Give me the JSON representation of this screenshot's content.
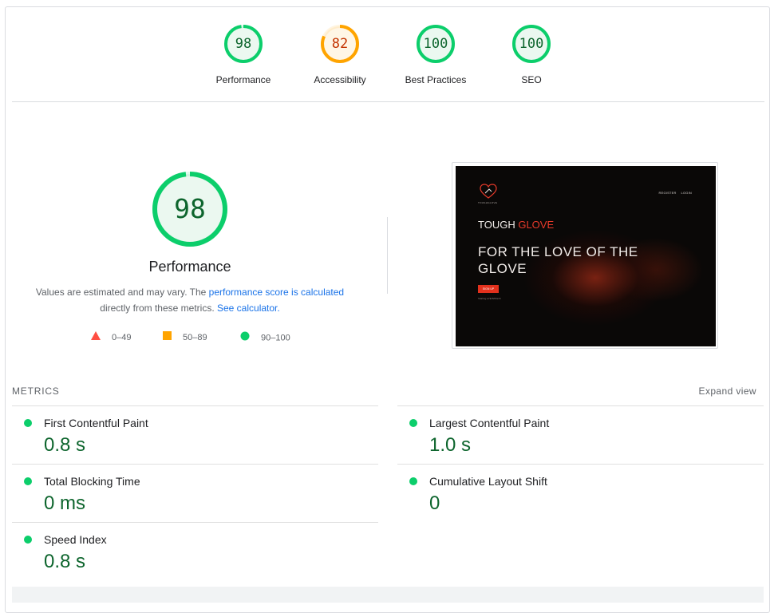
{
  "gauges": [
    {
      "score": "98",
      "label": "Performance",
      "value": 98,
      "color": "#0cce6b",
      "text_color": "#0d652d",
      "fill": "#ebf8f0"
    },
    {
      "score": "82",
      "label": "Accessibility",
      "value": 82,
      "color": "#ffa400",
      "text_color": "#c33300",
      "fill": "#fff6e6"
    },
    {
      "score": "100",
      "label": "Best Practices",
      "value": 100,
      "color": "#0cce6b",
      "text_color": "#0d652d",
      "fill": "#ebf8f0"
    },
    {
      "score": "100",
      "label": "SEO",
      "value": 100,
      "color": "#0cce6b",
      "text_color": "#0d652d",
      "fill": "#ebf8f0"
    }
  ],
  "performance": {
    "score": "98",
    "value": 98,
    "title": "Performance",
    "desc_prefix": "Values are estimated and may vary. The ",
    "desc_link": "performance score is calculated",
    "desc_mid": "directly from these metrics.",
    "desc_link2": "See calculator.",
    "legend": {
      "fail": "0–49",
      "average": "50–89",
      "pass": "90–100"
    },
    "colors": {
      "fail": "#ff4e42",
      "average": "#ffa400",
      "pass": "#0cce6b"
    }
  },
  "screenshot": {
    "nav_register": "REGISTER",
    "nav_login": "LOGIN",
    "brand_main": "TOUGH ",
    "brand_accent": "GLOVE",
    "headline": "FOR THE LOVE OF THE GLOVE",
    "signup": "SIGN UP",
    "note": "Starting at $15/Month"
  },
  "metrics": {
    "header": "METRICS",
    "expand": "Expand view",
    "items": [
      {
        "title": "First Contentful Paint",
        "value": "0.8 s"
      },
      {
        "title": "Largest Contentful Paint",
        "value": "1.0 s"
      },
      {
        "title": "Total Blocking Time",
        "value": "0 ms"
      },
      {
        "title": "Cumulative Layout Shift",
        "value": "0"
      },
      {
        "title": "Speed Index",
        "value": "0.8 s"
      }
    ]
  }
}
